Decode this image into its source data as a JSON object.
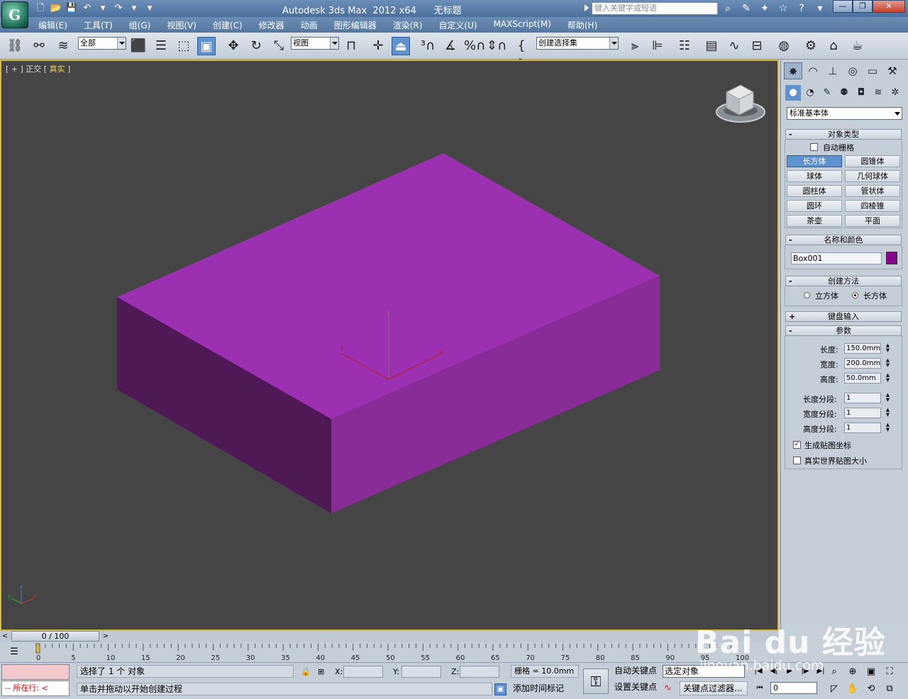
{
  "window": {
    "title": "Autodesk 3ds Max  2012 x64      无标题",
    "search_placeholder": "键入关键字或短语"
  },
  "menu": [
    "编辑(E)",
    "工具(T)",
    "组(G)",
    "视图(V)",
    "创建(C)",
    "修改器",
    "动画",
    "图形编辑器",
    "渲染(R)",
    "自定义(U)",
    "MAXScript(M)",
    "帮助(H)"
  ],
  "toolbar": {
    "selection_filter": "全部",
    "ref_coord": "视图",
    "named_selection": "创建选择集"
  },
  "viewport": {
    "label_prefix": "[ + ] 正交 [ ",
    "label_shading": "真实",
    "label_suffix": " ]",
    "box_color": "#9b30b0"
  },
  "command_panel": {
    "category": "标准基本体",
    "object_type": {
      "title": "对象类型",
      "autogrid": "自动栅格",
      "buttons": [
        "长方体",
        "圆锥体",
        "球体",
        "几何球体",
        "圆柱体",
        "管状体",
        "圆环",
        "四棱锥",
        "茶壶",
        "平面"
      ],
      "active": "长方体"
    },
    "name_color": {
      "title": "名称和颜色",
      "name": "Box001",
      "color": "#86058a"
    },
    "creation_method": {
      "title": "创建方法",
      "options": [
        "立方体",
        "长方体"
      ],
      "selected": "长方体"
    },
    "keyboard_entry": "键盘输入",
    "parameters": {
      "title": "参数",
      "length_label": "长度:",
      "length": "150.0mm",
      "width_label": "宽度:",
      "width": "200.0mm",
      "height_label": "高度:",
      "height": "50.0mm",
      "length_segs_label": "长度分段:",
      "length_segs": "1",
      "width_segs_label": "宽度分段:",
      "width_segs": "1",
      "height_segs_label": "高度分段:",
      "height_segs": "1",
      "gen_map_coords": "生成贴图坐标",
      "real_world_map": "真实世界贴图大小"
    }
  },
  "timeline": {
    "frame_display": "0 / 100",
    "ticks": [
      "0",
      "5",
      "10",
      "15",
      "20",
      "25",
      "30",
      "35",
      "40",
      "45",
      "50",
      "55",
      "60",
      "65",
      "70",
      "75",
      "80",
      "85",
      "90",
      "95",
      "100"
    ]
  },
  "status": {
    "current_label": "所在行:",
    "selection": "选择了 1 个 对象",
    "prompt": "单击并拖动以开始创建过程",
    "x_label": "X:",
    "y_label": "Y:",
    "z_label": "Z:",
    "grid": "栅格 = 10.0mm",
    "add_time_tag": "添加时间标记",
    "auto_key": "自动关键点",
    "set_key": "设置关键点",
    "selected_object": "选定对象",
    "key_filters": "关键点过滤器...",
    "frame": "0"
  },
  "watermark": {
    "brand": "Bai du 经验",
    "url": "jingyan.baidu.com"
  }
}
